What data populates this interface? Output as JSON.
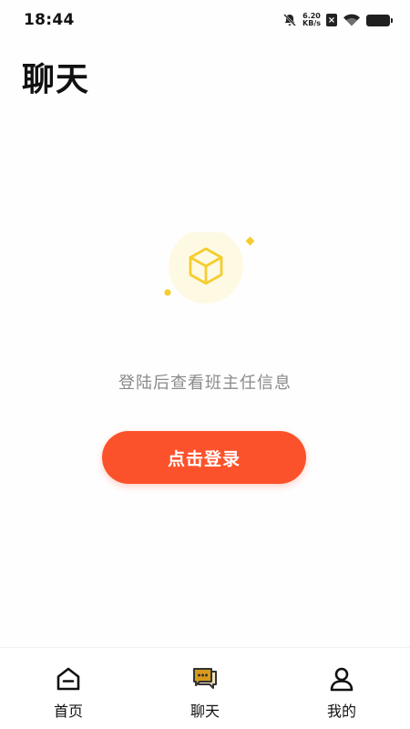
{
  "status_bar": {
    "time": "18:44",
    "speed_value": "6.20",
    "speed_unit": "KB/s",
    "icons": [
      "bell-muted-icon",
      "close-box-icon",
      "wifi-icon",
      "battery-icon"
    ]
  },
  "header": {
    "title": "聊天"
  },
  "empty_state": {
    "illustration": "cube-icon",
    "message": "登陆后查看班主任信息",
    "login_button_label": "点击登录"
  },
  "bottom_nav": {
    "items": [
      {
        "label": "首页",
        "icon": "home-icon"
      },
      {
        "label": "聊天",
        "icon": "chat-icon"
      },
      {
        "label": "我的",
        "icon": "profile-icon"
      }
    ]
  },
  "colors": {
    "accent": "#fc522b",
    "illustration_yellow": "#f5cd2f",
    "illustration_bg": "#fdf9e3",
    "chat_icon_fill": "#d89a1c"
  }
}
